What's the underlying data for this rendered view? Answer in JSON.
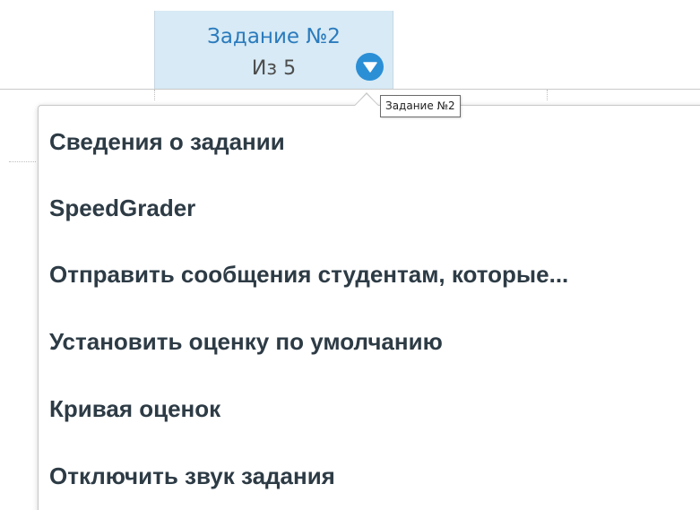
{
  "column_header": {
    "title": "Задание №2",
    "subtitle": "Из 5",
    "menu_icon": "chevron-down-circle-icon"
  },
  "tooltip": {
    "text": "Задание №2"
  },
  "menu": {
    "items": [
      {
        "label": "Сведения о задании"
      },
      {
        "label": "SpeedGrader"
      },
      {
        "label": "Отправить сообщения студентам, которые..."
      },
      {
        "label": "Установить оценку по умолчанию"
      },
      {
        "label": "Кривая оценок"
      },
      {
        "label": "Отключить звук задания"
      }
    ]
  },
  "colors": {
    "header_bg": "#d7eaf5",
    "header_title": "#2b7bbd",
    "accent": "#2b8fd6",
    "menu_text": "#2d3b45"
  }
}
